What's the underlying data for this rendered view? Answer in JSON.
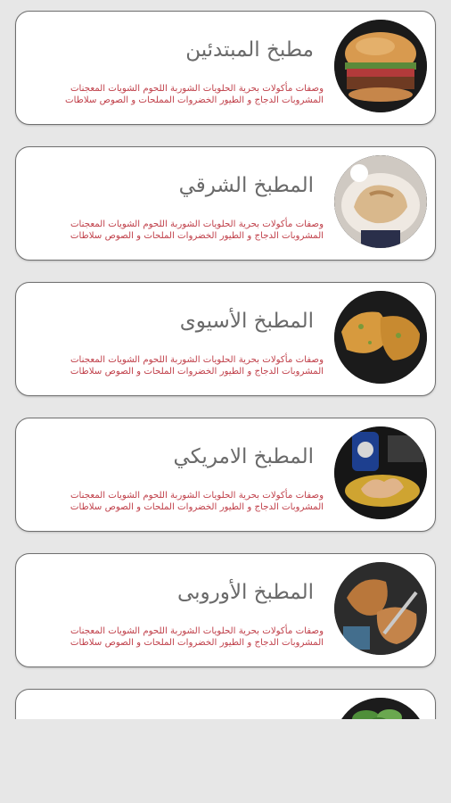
{
  "cards": [
    {
      "title": "مطبخ المبتدئين",
      "desc": "وصفات مأكولات بحرية الحلويات الشوربة اللحوم الشويات المعجنات المشروبات الدجاج و الطيور الخضروات المملحات و الصوص سلاطات",
      "image_icon": "burger-image"
    },
    {
      "title": "المطبخ الشرقي",
      "desc": "وصفات مأكولات بحرية الحلويات الشوربة اللحوم الشويات المعجنات المشروبات الدجاج و الطيور الخضروات الملحات و الصوص سلاطات",
      "image_icon": "chicken-plate-image"
    },
    {
      "title": "المطبخ الأسيوى",
      "desc": "وصفات مأكولات بحرية الحلويات الشوربة اللحوم الشويات المعجنات المشروبات الدجاج و الطيور الخضروات الملحات و الصوص سلاطات",
      "image_icon": "fried-chicken-image"
    },
    {
      "title": "المطبخ الامريكي",
      "desc": "وصفات مأكولات بحرية الحلويات الشوربة اللحوم الشويات المعجنات المشروبات الدجاج و الطيور الخضروات الملحات و الصوص سلاطات",
      "image_icon": "chicken-wings-image"
    },
    {
      "title": "المطبخ الأوروبى",
      "desc": "وصفات مأكولات بحرية الحلويات الشوربة اللحوم الشويات المعجنات المشروبات الدجاج و الطيور الخضروات الملحات و الصوص سلاطات",
      "image_icon": "baked-chicken-image"
    },
    {
      "title": "",
      "desc": "",
      "image_icon": "salad-image"
    }
  ],
  "colors": {
    "title": "#6a6a6a",
    "desc": "#c0404a",
    "card_border": "#6f6f6f",
    "background": "#e7e7e7"
  }
}
